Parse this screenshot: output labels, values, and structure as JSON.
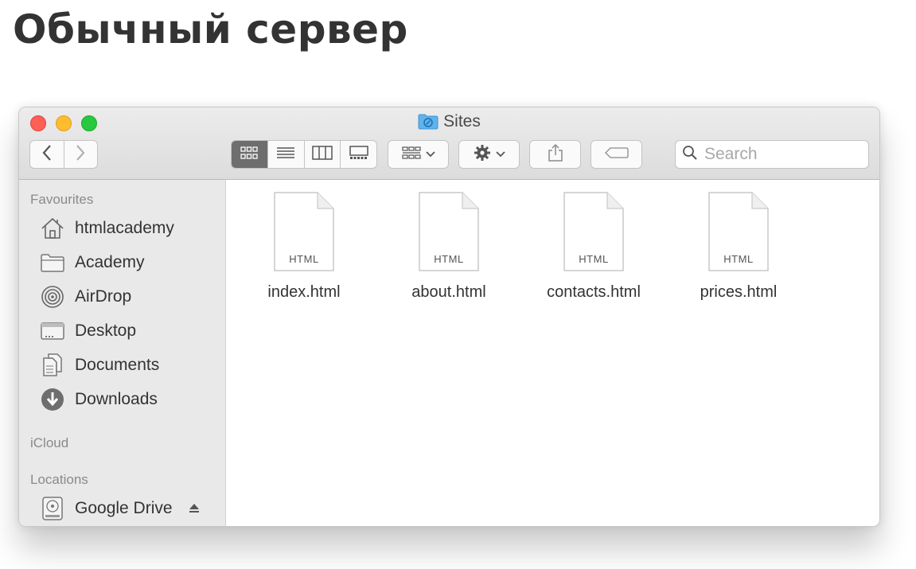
{
  "heading": "Обычный сервер",
  "window": {
    "title": "Sites",
    "traffic_lights": {
      "close": "#fe5f57",
      "minimize": "#febc2e",
      "zoom": "#28c840"
    },
    "toolbar": {
      "back_icon": "chevron-left-icon",
      "forward_icon": "chevron-right-icon",
      "view_modes": [
        "icon-view",
        "list-view",
        "column-view",
        "gallery-view"
      ],
      "active_view": "icon-view",
      "search_placeholder": "Search"
    },
    "sidebar": {
      "favourites_header": "Favourites",
      "favourites": [
        {
          "label": "htmlacademy",
          "icon": "home-icon"
        },
        {
          "label": "Academy",
          "icon": "folder-icon"
        },
        {
          "label": "AirDrop",
          "icon": "airdrop-icon"
        },
        {
          "label": "Desktop",
          "icon": "desktop-icon"
        },
        {
          "label": "Documents",
          "icon": "documents-icon"
        },
        {
          "label": "Downloads",
          "icon": "downloads-icon"
        }
      ],
      "icloud_header": "iCloud",
      "locations_header": "Locations",
      "locations": [
        {
          "label": "Google Drive",
          "icon": "drive-icon"
        }
      ]
    },
    "files": [
      {
        "name": "index.html",
        "type_label": "HTML"
      },
      {
        "name": "about.html",
        "type_label": "HTML"
      },
      {
        "name": "contacts.html",
        "type_label": "HTML"
      },
      {
        "name": "prices.html",
        "type_label": "HTML"
      }
    ]
  }
}
